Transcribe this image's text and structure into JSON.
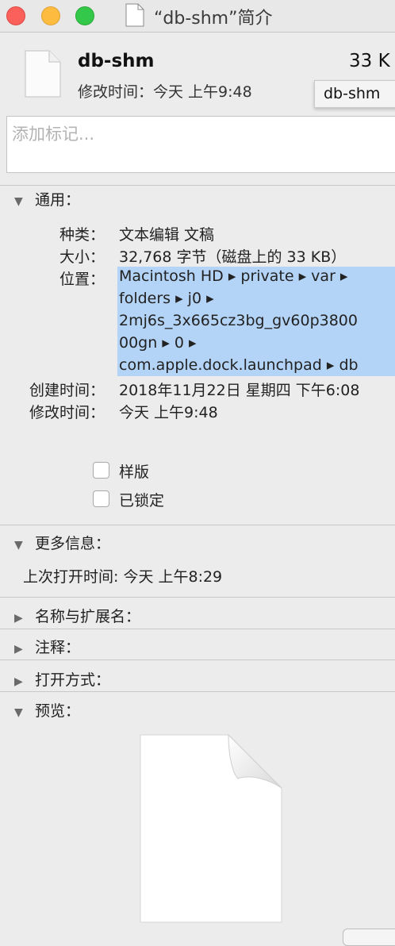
{
  "window": {
    "title": "“db-shm”简介"
  },
  "header": {
    "file_name": "db-shm",
    "file_size": "33 K",
    "modified_line": "修改时间：今天 上午9:48",
    "tooltip": "db-shm",
    "tags_placeholder": "添加标记..."
  },
  "general": {
    "title": "通用：",
    "kind_label": "种类：",
    "kind_value": "文本编辑 文稿",
    "size_label": "大小：",
    "size_value": "32,768 字节（磁盘上的 33 KB）",
    "where_label": "位置：",
    "where_lines": [
      "Macintosh HD ▸ private ▸ var ▸",
      "folders ▸ j0 ▸",
      "2mj6s_3x665cz3bg_gv60p3800",
      "00gn ▸ 0 ▸",
      "com.apple.dock.launchpad ▸ db"
    ],
    "created_label": "创建时间：",
    "created_value": "2018年11月22日 星期四 下午6:08",
    "modified_label": "修改时间：",
    "modified_value": "今天 上午9:48",
    "stationery_label": "样版",
    "locked_label": "已锁定",
    "stationery_checked": false,
    "locked_checked": false
  },
  "more_info": {
    "title": "更多信息：",
    "last_opened": "上次打开时间: 今天 上午8:29"
  },
  "sections": {
    "name_ext": "名称与扩展名：",
    "comments": "注释：",
    "open_with": "打开方式：",
    "preview": "预览："
  },
  "colors": {
    "selection": "#b4d4f7",
    "close": "#fc605b",
    "minimize": "#fdbc40",
    "zoom": "#34c84a"
  }
}
